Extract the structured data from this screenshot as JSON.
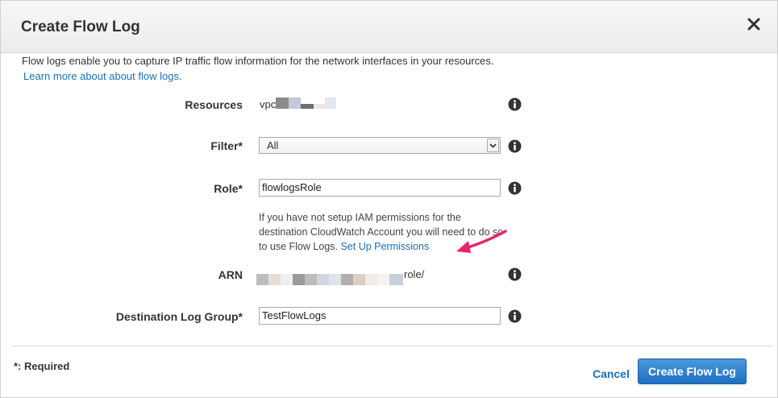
{
  "dialog": {
    "title": "Create Flow Log",
    "intro": "Flow logs enable you to capture IP traffic flow information for the network interfaces in your resources.",
    "learn_more": "Learn more about about flow logs",
    "learn_more_suffix": "."
  },
  "form": {
    "resources_label": "Resources",
    "resources_value": "vpc",
    "filter_label": "Filter*",
    "filter_value": "All",
    "role_label": "Role*",
    "role_value": "flowlogsRole",
    "role_help": "If you have not setup IAM permissions for the destination CloudWatch Account you will need to do so to use Flow Logs.",
    "role_help_link": "Set Up Permissions",
    "arn_label": "ARN",
    "arn_suffix": "role/",
    "dest_label": "Destination Log Group*",
    "dest_value": "TestFlowLogs"
  },
  "footer": {
    "required_note": "*: Required",
    "cancel": "Cancel",
    "create": "Create Flow Log"
  },
  "colors": {
    "link": "#1a6fb5",
    "primary": "#2a7ccd",
    "annotation": "#e8246b"
  },
  "icons": {
    "close": "close-icon",
    "info": "info-icon"
  }
}
